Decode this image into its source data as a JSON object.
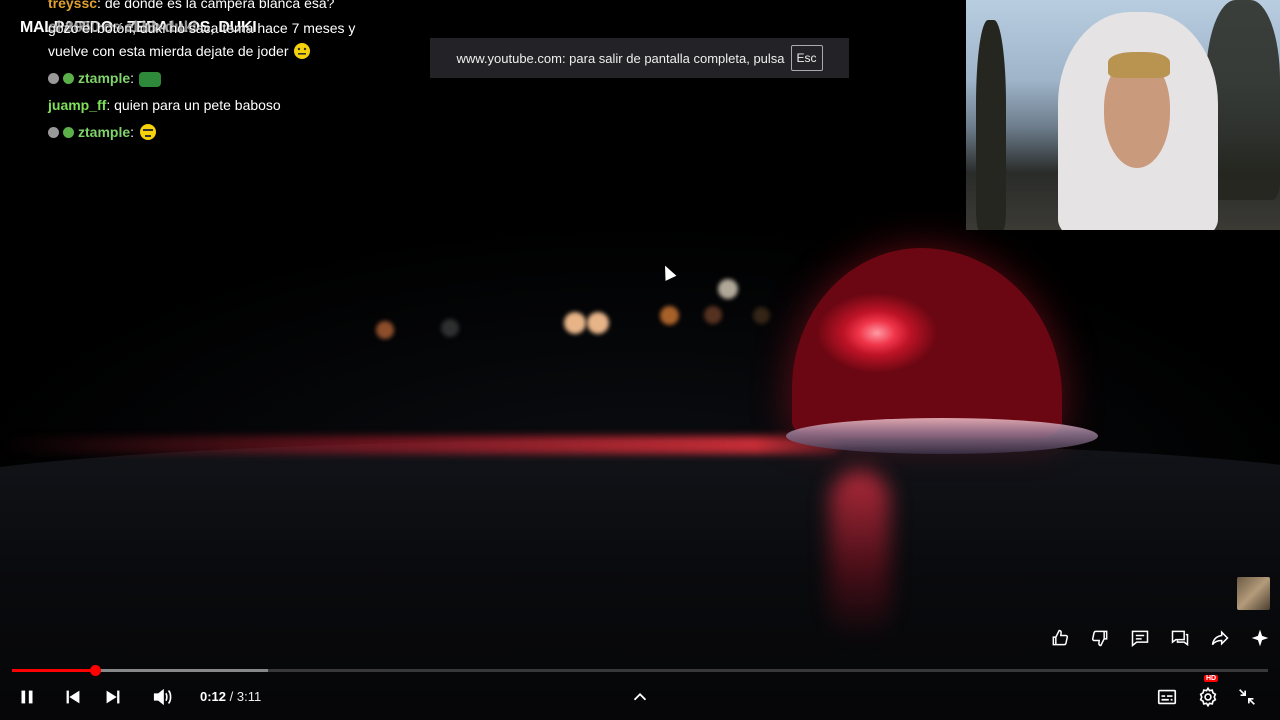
{
  "chat": {
    "title": "MALPARIDO - ZEBALLOS, DUKI",
    "title_ghost": "el 2050 es el bb duki",
    "messages": [
      {
        "user": "treyssc",
        "user_color": "#e0a030",
        "text": ": de donde es la campera blanca esa?"
      },
      {
        "user": "",
        "user_color": "#6aa0ff",
        "text": "gozo el botón, duki no saca tema hace 7 meses y vuelve con esta mierda dejate de joder"
      },
      {
        "user": "ztample",
        "user_color": "#7fd36a",
        "text": ":"
      },
      {
        "user": "juamp_ff",
        "user_color": "#7ee05a",
        "text": ": quien para un pete baboso"
      },
      {
        "user": "ztample",
        "user_color": "#7fd36a",
        "text": ":"
      }
    ]
  },
  "fullscreen_notice": {
    "text": "www.youtube.com: para salir de pantalla completa, pulsa",
    "key": "Esc"
  },
  "actions": {
    "like": "thumb-up-icon",
    "dislike": "thumb-down-icon",
    "comments": "comment-icon",
    "chat": "live-chat-icon",
    "share": "share-icon",
    "ask": "sparkle-icon"
  },
  "player": {
    "current_time": "0:12",
    "separator": " / ",
    "duration": "3:11",
    "progress_played": 0.066,
    "progress_buffered": 0.204,
    "quality_badge": "HD"
  },
  "colors": {
    "progress_red": "#ff0000",
    "beacon_red": "#f0354a"
  }
}
